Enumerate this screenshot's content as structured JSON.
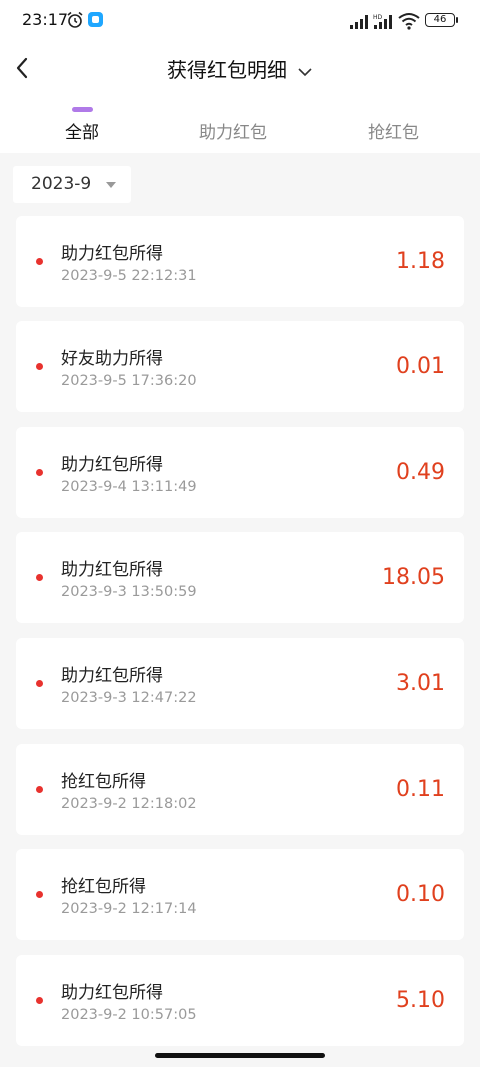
{
  "status_bar": {
    "time": "23:17",
    "battery": "46",
    "icons": [
      "alarm-icon",
      "app-icon",
      "signal-icon",
      "hd-signal-icon",
      "wifi-icon",
      "battery-icon"
    ]
  },
  "header": {
    "title": "获得红包明细",
    "back_icon": "chevron-left-icon",
    "title_dropdown_icon": "chevron-down-icon"
  },
  "tabs": [
    {
      "label": "全部",
      "active": true
    },
    {
      "label": "助力红包",
      "active": false
    },
    {
      "label": "抢红包",
      "active": false
    }
  ],
  "accent_color": "#b07ae8",
  "amount_color": "#e0401e",
  "dot_color": "#e8322e",
  "month_filter": {
    "value": "2023-9"
  },
  "records": [
    {
      "name": "助力红包所得",
      "time": "2023-9-5 22:12:31",
      "amount": "1.18"
    },
    {
      "name": "好友助力所得",
      "time": "2023-9-5 17:36:20",
      "amount": "0.01"
    },
    {
      "name": "助力红包所得",
      "time": "2023-9-4 13:11:49",
      "amount": "0.49"
    },
    {
      "name": "助力红包所得",
      "time": "2023-9-3 13:50:59",
      "amount": "18.05"
    },
    {
      "name": "助力红包所得",
      "time": "2023-9-3 12:47:22",
      "amount": "3.01"
    },
    {
      "name": "抢红包所得",
      "time": "2023-9-2 12:18:02",
      "amount": "0.11"
    },
    {
      "name": "抢红包所得",
      "time": "2023-9-2 12:17:14",
      "amount": "0.10"
    },
    {
      "name": "助力红包所得",
      "time": "2023-9-2 10:57:05",
      "amount": "5.10"
    }
  ]
}
